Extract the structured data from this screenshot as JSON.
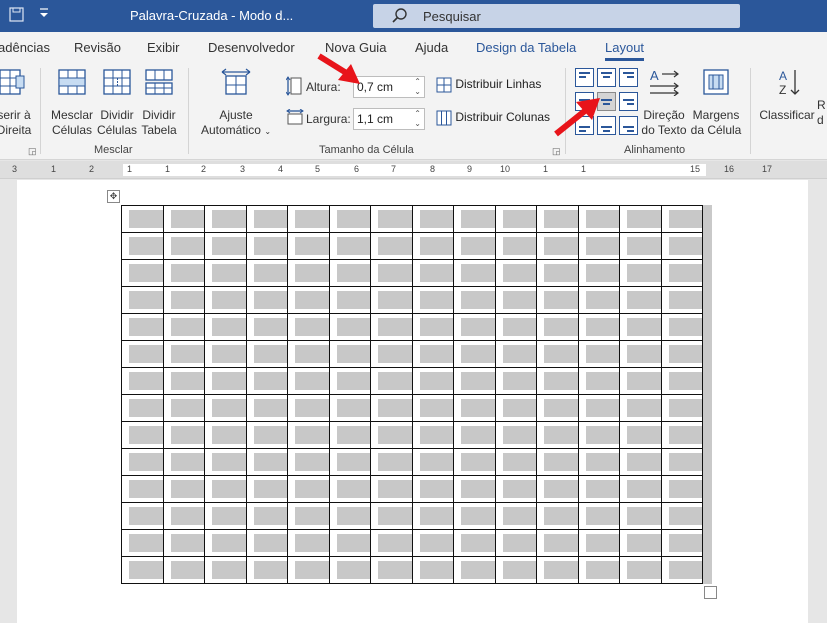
{
  "window": {
    "title": "Palavra-Cruzada  -  Modo d...",
    "search_placeholder": "Pesquisar"
  },
  "tabs": [
    {
      "label": "adências"
    },
    {
      "label": "Revisão"
    },
    {
      "label": "Exibir"
    },
    {
      "label": "Desenvolvedor"
    },
    {
      "label": "Nova Guia"
    },
    {
      "label": "Ajuda"
    },
    {
      "label": "Design da Tabela"
    },
    {
      "label": "Layout",
      "active": true
    }
  ],
  "ribbon": {
    "insert_right": {
      "line1": "serir à",
      "line2": "Direita"
    },
    "merge_cells": {
      "line1": "Mesclar",
      "line2": "Células"
    },
    "split_cells": {
      "line1": "Dividir",
      "line2": "Células"
    },
    "split_table": {
      "line1": "Dividir",
      "line2": "Tabela"
    },
    "merge_group": "Mesclar",
    "autofit": {
      "line1": "Ajuste",
      "line2": "Automático"
    },
    "height_label": "Altura:",
    "height_value": "0,7 cm",
    "width_label": "Largura:",
    "width_value": "1,1 cm",
    "distribute_rows": "Distribuir Linhas",
    "distribute_cols": "Distribuir Colunas",
    "cell_size_group": "Tamanho da Célula",
    "text_direction": {
      "line1": "Direção",
      "line2": "do Texto"
    },
    "cell_margins": {
      "line1": "Margens",
      "line2": "da Célula"
    },
    "alignment_group": "Alinhamento",
    "sort": {
      "line1": "Classificar"
    },
    "next_partial": {
      "line1": "R",
      "line2": "d"
    }
  },
  "ruler": {
    "labels": [
      "3",
      "1",
      "2",
      "1",
      "1",
      "2",
      "3",
      "4",
      "5",
      "6",
      "7",
      "8",
      "9",
      "10",
      "1",
      "1",
      "15",
      "16",
      "17"
    ]
  },
  "table": {
    "rows": 14,
    "cols": 14
  },
  "colors": {
    "accent": "#2b579a",
    "annotation_arrow": "#e8141a",
    "cell_shading": "#c8c8c8"
  },
  "icons": [
    "save-icon",
    "customize-quick-access-icon",
    "search-icon",
    "table-move-handle-icon",
    "table-resize-handle-icon"
  ]
}
